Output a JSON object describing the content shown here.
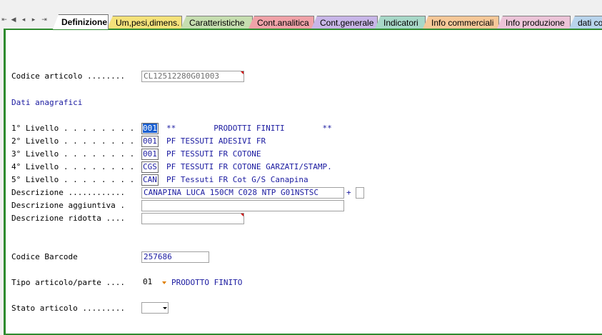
{
  "nav": {
    "first": "⇤",
    "prev": "◀",
    "prev2": "◂",
    "next": "▸",
    "last": "⇥"
  },
  "tabs": [
    {
      "label": "Definizione",
      "color": "#ffffff"
    },
    {
      "label": "Um,pesi,dimens.",
      "color": "#f5e27a"
    },
    {
      "label": "Caratteristiche",
      "color": "#c6deb0"
    },
    {
      "label": "Cont.analitica",
      "color": "#f0a2a8"
    },
    {
      "label": "Cont.generale",
      "color": "#c8b6e8"
    },
    {
      "label": "Indicatori",
      "color": "#a8d8c8"
    },
    {
      "label": "Info commerciali",
      "color": "#f6c898"
    },
    {
      "label": "Info produzione",
      "color": "#ecc4d8"
    },
    {
      "label": "dati co",
      "color": "#b8d4ec"
    }
  ],
  "form": {
    "codice_label": "Codice articolo ........",
    "codice_value": "CL12512280G01003",
    "dati_anagrafici": "Dati anagrafici",
    "levels": [
      {
        "label": "1° Livello . . . . . . . .",
        "code": "001",
        "desc": "**        PRODOTTI FINITI        **"
      },
      {
        "label": "2° Livello . . . . . . . .",
        "code": "001",
        "desc": "PF TESSUTI ADESIVI FR"
      },
      {
        "label": "3° Livello . . . . . . . .",
        "code": "001",
        "desc": "PF TESSUTI FR COTONE"
      },
      {
        "label": "4° Livello . . . . . . . .",
        "code": "CGS",
        "desc": "PF TESSUTI FR COTONE GARZATI/STAMP."
      },
      {
        "label": "5° Livello . . . . . . . .",
        "code": "CAN",
        "desc": "PF Tessuti FR Cot G/S Canapina"
      }
    ],
    "descrizione_label": "Descrizione ............",
    "descrizione_value": "CANAPINA LUCA 150CM C028 NTP G01NSTSC",
    "plus": "+",
    "descr_agg_label": "Descrizione aggiuntiva .",
    "descr_agg_value": "",
    "descr_rid_label": "Descrizione ridotta ....",
    "descr_rid_value": "",
    "barcode_label": "Codice Barcode",
    "barcode_value": "257686",
    "tipo_label": "Tipo articolo/parte ....",
    "tipo_value": "01",
    "tipo_desc": "PRODOTTO FINITO",
    "stato_label": "Stato articolo .........",
    "stato_value": ""
  }
}
